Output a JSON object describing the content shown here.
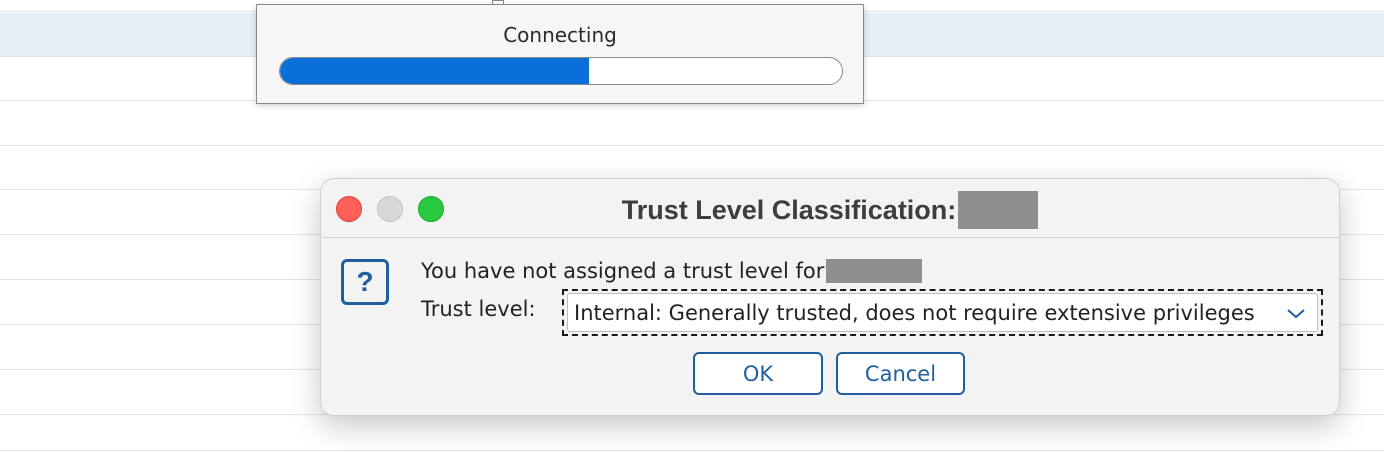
{
  "progress_popup": {
    "label": "Connecting",
    "progress_percent": 55
  },
  "dialog": {
    "title": "Trust Level Classification:",
    "message": "You have not assigned a trust level for",
    "trust_label": "Trust level:",
    "trust_value": "Internal: Generally trusted, does not require extensive privileges",
    "ok_label": "OK",
    "cancel_label": "Cancel",
    "question_glyph": "?",
    "icon": "question-icon"
  },
  "colors": {
    "accent": "#1f5f9f",
    "progress_fill": "#0a6fd8",
    "close": "#fe5f57",
    "minimize": "#d8d8d8",
    "zoom": "#28c840",
    "selected_row": "#e6eef8"
  }
}
